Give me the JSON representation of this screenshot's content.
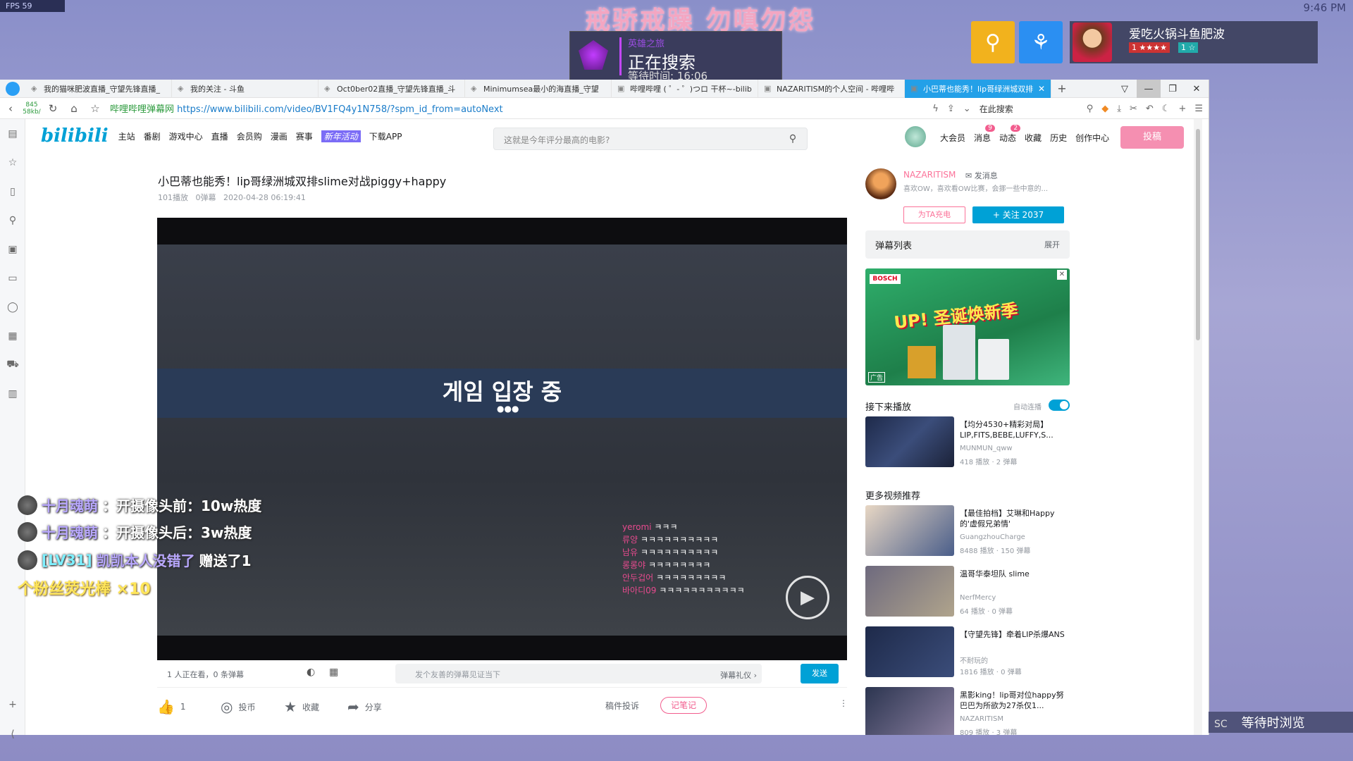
{
  "overlay": {
    "fps": "FPS 59",
    "clock": "9:46 PM",
    "title": "戒骄戒躁 勿嗔勿怨",
    "search_small": "英雄之旅",
    "search_status": "正在搜索",
    "search_timer": "等待时间: 16:06",
    "profile_name": "爱吃火锅斗鱼肥波",
    "profile_lv": "1 ★★★★",
    "profile_lv2": "1 ☆",
    "waiting_prefix": "SC",
    "waiting": "等待时浏览"
  },
  "browser": {
    "tabs": [
      {
        "label": "我的猫咪肥波直播_守望先锋直播_",
        "icon": "douyu-icon"
      },
      {
        "label": "我的关注 - 斗鱼",
        "icon": "douyu-icon"
      },
      {
        "label": "Oct0ber02直播_守望先锋直播_斗",
        "icon": "douyu-icon"
      },
      {
        "label": "Minimumsea最小的海直播_守望",
        "icon": "douyu-icon"
      },
      {
        "label": "哔哩哔哩 ( ゜- ゜)つロ 干杯~-bilib",
        "icon": "bilibili-icon"
      },
      {
        "label": "NAZARITISM的个人空间 - 哔哩哔",
        "icon": "bilibili-icon"
      },
      {
        "label": "小巴蒂也能秀！lip哥绿洲城双排",
        "icon": "bilibili-icon",
        "active": true
      }
    ],
    "url_prefix": "哔哩哔哩弹幕网",
    "url": "https://www.bilibili.com/video/BV1FQ4y1N758/?spm_id_from=autoNext",
    "addr_search": "在此搜索",
    "speed_up": "845",
    "speed_down": "58kb/"
  },
  "bili": {
    "logo": "bilibili",
    "nav": [
      "主站",
      "番剧",
      "游戏中心",
      "直播",
      "会员购",
      "漫画",
      "赛事",
      "新年活动",
      "下载APP"
    ],
    "search_placeholder": "这就是今年评分最高的电影?",
    "right_nav": [
      {
        "label": "大会员"
      },
      {
        "label": "消息",
        "badge": "9"
      },
      {
        "label": "动态",
        "badge": "2"
      },
      {
        "label": "收藏"
      },
      {
        "label": "历史"
      },
      {
        "label": "创作中心"
      }
    ],
    "upload": "投稿"
  },
  "video": {
    "title": "小巴蒂也能秀！lip哥绿洲城双排slime对战piggy+happy",
    "plays": "101播放",
    "danmaku": "0弹幕",
    "date": "2020-04-28 06:19:41",
    "banner": "게임 입장 중",
    "chat": [
      {
        "name": "yeromi",
        "text": "ㅋㅋㅋ"
      },
      {
        "name": "류양",
        "text": "ㅋㅋㅋㅋㅋㅋㅋㅋㅋㅋ"
      },
      {
        "name": "남유",
        "text": "ㅋㅋㅋㅋㅋㅋㅋㅋㅋㅋ"
      },
      {
        "name": "롱롱야",
        "text": "ㅋㅋㅋㅋㅋㅋㅋㅋ"
      },
      {
        "name": "안두겁어",
        "text": "ㅋㅋㅋㅋㅋㅋㅋㅋㅋ"
      },
      {
        "name": "바아디09",
        "text": "ㅋㅋㅋㅋㅋㅋㅋㅋㅋㅋㅋ"
      }
    ],
    "live_count": "1 人正在看，0 条弹幕",
    "dm_placeholder": "发个友善的弹幕见证当下",
    "dm_etiquette": "弹幕礼仪 ›",
    "send": "发送"
  },
  "actions": {
    "like": "1",
    "coin": "投币",
    "fav": "收藏",
    "share": "分享",
    "report": "稿件投诉",
    "note": "记笔记"
  },
  "up": {
    "name": "NAZARITISM",
    "msg": "发消息",
    "desc": "喜欢OW，喜欢看OW比赛，会挪一些中意的...",
    "charge": "为TA充电",
    "follow": "+ 关注 2037"
  },
  "dmlist": {
    "title": "弹幕列表",
    "expand": "展开"
  },
  "ad": {
    "brand": "BOSCH",
    "headline": "UP! 圣诞焕新季",
    "tag": "广告"
  },
  "next": {
    "title": "接下来播放",
    "auto": "自动连播",
    "video": {
      "title": "【均分4530+精彩对局】LIP,FITS,BEBE,LUFFY,S...",
      "author": "MUNMUN_qww",
      "stats": "418 播放 · 2 弹幕"
    }
  },
  "more": {
    "title": "更多视频推荐",
    "videos": [
      {
        "title": "【最佳拍档】艾琳和Happy的'虚假兄弟情'",
        "author": "GuangzhouCharge",
        "stats": "8488 播放 · 150 弹幕"
      },
      {
        "title": "温哥华泰坦队 slime",
        "author": "NerfMercy",
        "stats": "64 播放 · 0 弹幕"
      },
      {
        "title": "【守望先锋】牵着LIP杀爆ANS",
        "author": "不耐玩的",
        "stats": "1816 播放 · 0 弹幕"
      },
      {
        "title": "黑影king！lip哥对位happy努巴巴为所欲为27杀仅1...",
        "author": "NAZARITISM",
        "stats": "809 播放 · 3 弹幕"
      }
    ]
  },
  "stream_chat": [
    {
      "name": "十月魂萌",
      "text": "：开摄像头前：10w热度"
    },
    {
      "name": "十月魂萌",
      "text": "：开摄像头后：3w热度"
    },
    {
      "level": "[LV31]",
      "name": "凯凯本人没错了",
      "text": "赠送了1"
    }
  ],
  "gift": "个粉丝荧光棒 ×10"
}
